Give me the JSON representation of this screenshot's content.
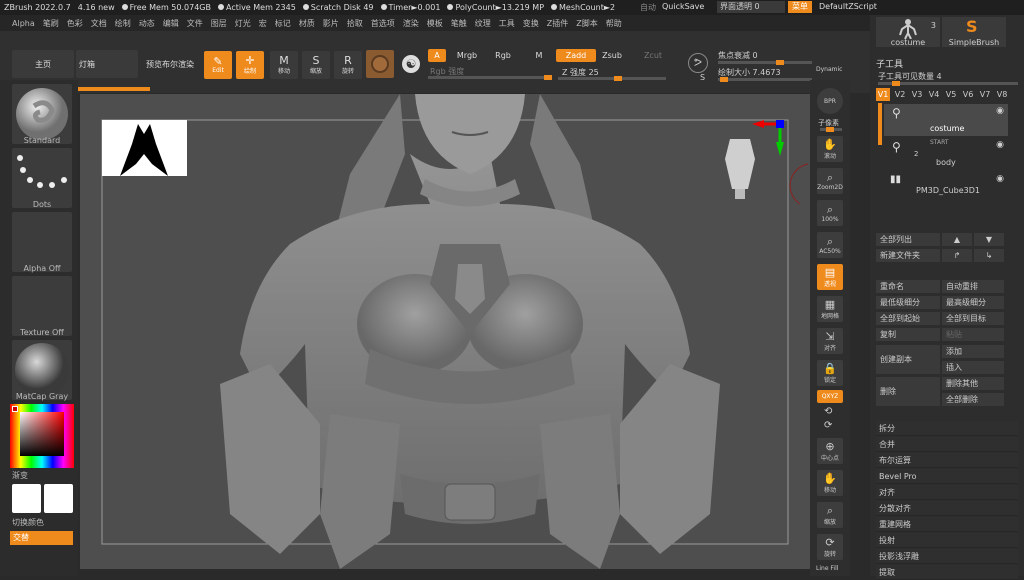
{
  "titlebar": {
    "app": "ZBrush 2022.0.7",
    "version": "4.16 new",
    "free_mem": "Free Mem 50.074GB",
    "active_mem": "Active Mem 2345",
    "scratch": "Scratch Disk 49",
    "timer": "Timer►0.001",
    "polycount": "PolyCount►13.219 MP",
    "meshcount": "MeshCount►2",
    "auto": "自动",
    "quicksave": "QuickSave",
    "transparency": "界面透明 0",
    "menu_btn": "菜单",
    "script": "DefaultZScript"
  },
  "menubar": [
    "Alpha",
    "笔刷",
    "色彩",
    "文档",
    "绘制",
    "动态",
    "编辑",
    "文件",
    "图层",
    "灯光",
    "宏",
    "标记",
    "材质",
    "影片",
    "拾取",
    "首选项",
    "渲染",
    "模板",
    "笔触",
    "纹理",
    "工具",
    "变换",
    "Z插件",
    "Z脚本",
    "帮助"
  ],
  "toolbar": {
    "home": "主页",
    "lightbox": "灯箱",
    "preview": "预览布尔渲染",
    "edit": "Edit",
    "draw": "绘制",
    "move": "移动",
    "scale": "缩放",
    "rotate": "旋转",
    "a": "A",
    "mrgb": "Mrgb",
    "rgb": "Rgb",
    "m": "M",
    "zadd": "Zadd",
    "zsub": "Zsub",
    "zcut": "Zcut",
    "rgb_intensity": "Rgb 强度",
    "z_intensity": "Z 强度 25",
    "focal": "焦点衰减 0",
    "draw_size": "绘制大小 7.4673",
    "dynamic": "Dynamic",
    "s_label": "S"
  },
  "leftpanel": {
    "standard": "Standard",
    "dots": "Dots",
    "alpha_off": "Alpha Off",
    "texture_off": "Texture Off",
    "matcap": "MatCap Gray",
    "gradient": "渐变",
    "switch_color": "切换颜色",
    "alternate": "交替"
  },
  "rightstrip": {
    "bpr": "BPR",
    "subpixel": "子像素",
    "scroll": "滚动",
    "zoom2d": "Zoom2D",
    "zoom100": "100%",
    "ac50": "AC50%",
    "perspective": "透视",
    "floor": "地网格",
    "local": "对齐",
    "lock": "锁定",
    "xyz": "QXYZ",
    "frame": "中心点",
    "move": "移动",
    "zoom": "缩放",
    "rotate": "旋转",
    "linefill": "Line Fill"
  },
  "rightpanel": {
    "tool_count": "3",
    "costume_thumb": "costume",
    "simplebrush": "SimpleBrush",
    "subtool_title": "子工具",
    "visible_count": "子工具可见数量 4",
    "versions": [
      "V1",
      "V2",
      "V3",
      "V4",
      "V5",
      "V6",
      "V7",
      "V8"
    ],
    "subtools": [
      {
        "name": "costume"
      },
      {
        "name": "body",
        "num": "2",
        "tag": "START"
      },
      {
        "name": "PM3D_Cube3D1"
      }
    ],
    "list_all": "全部列出",
    "new_folder": "新建文件夹",
    "rename": "重命名",
    "auto_reorder": "自动重排",
    "lowest": "最低级细分",
    "highest": "最高级细分",
    "all_to_start": "全部到起始",
    "all_to_target": "全部到目标",
    "duplicate": "复制",
    "paste": "粘贴",
    "create_copy": "创建副本",
    "append": "添加",
    "insert": "插入",
    "delete": "删除",
    "delete_other": "删除其他",
    "delete_all": "全部删除",
    "items": [
      "拆分",
      "合并",
      "布尔运算",
      "Bevel Pro",
      "对齐",
      "分散对齐",
      "重建网格",
      "投射",
      "投影浅浮雕",
      "提取"
    ]
  },
  "colors": {
    "accent": "#ef8a1c",
    "viewport": "#4e4e4e",
    "clay": "#8c8c8c"
  }
}
